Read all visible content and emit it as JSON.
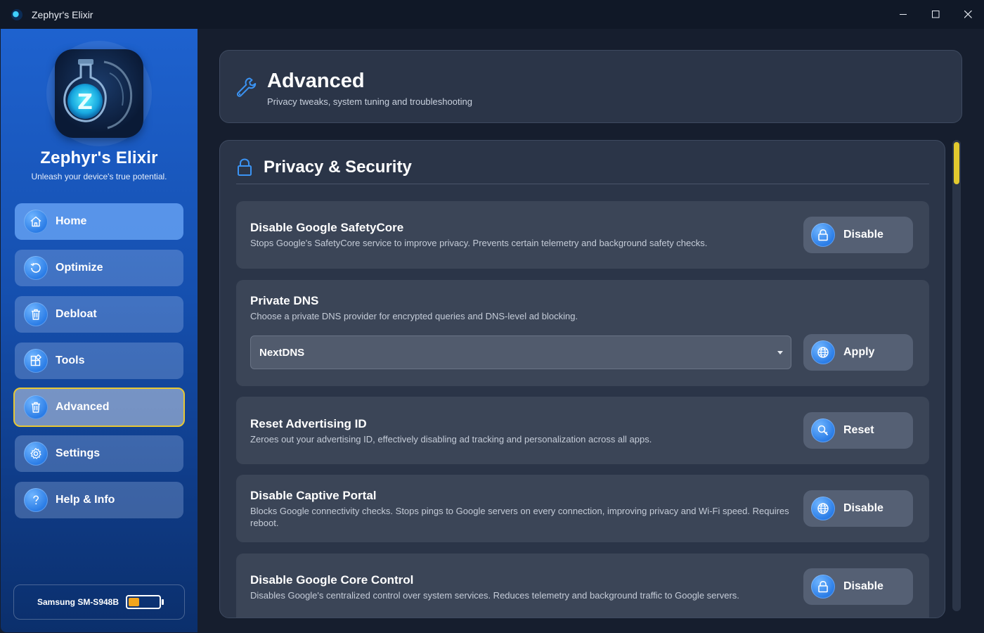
{
  "window": {
    "title": "Zephyr's Elixir"
  },
  "brand": {
    "name": "Zephyr's Elixir",
    "tagline": "Unleash your device's true potential."
  },
  "nav": [
    {
      "label": "Home",
      "icon": "home-icon"
    },
    {
      "label": "Optimize",
      "icon": "refresh-icon"
    },
    {
      "label": "Debloat",
      "icon": "trash-icon"
    },
    {
      "label": "Tools",
      "icon": "tools-icon"
    },
    {
      "label": "Advanced",
      "icon": "trash-icon",
      "active": true
    },
    {
      "label": "Settings",
      "icon": "gear-icon"
    },
    {
      "label": "Help & Info",
      "icon": "help-icon"
    }
  ],
  "device": {
    "name": "Samsung SM-S948B",
    "battery_level": 0.35
  },
  "header": {
    "title": "Advanced",
    "subtitle": "Privacy tweaks, system tuning and troubleshooting"
  },
  "section": {
    "title": "Privacy & Security"
  },
  "options": [
    {
      "title": "Disable Google SafetyCore",
      "desc": "Stops Google's SafetyCore service to improve privacy. Prevents certain telemetry and background safety checks.",
      "button": "Disable",
      "icon": "lock-icon"
    },
    {
      "title": "Private DNS",
      "desc": "Choose a private DNS provider for encrypted queries and DNS-level ad blocking.",
      "select_value": "NextDNS",
      "button": "Apply",
      "icon": "globe-icon"
    },
    {
      "title": "Reset Advertising ID",
      "desc": "Zeroes out your advertising ID, effectively disabling ad tracking and personalization across all apps.",
      "button": "Reset",
      "icon": "search-key-icon"
    },
    {
      "title": "Disable Captive Portal",
      "desc": "Blocks Google connectivity checks. Stops pings to Google servers on every connection, improving privacy and Wi-Fi speed. Requires reboot.",
      "button": "Disable",
      "icon": "globe-icon"
    },
    {
      "title": "Disable Google Core Control",
      "desc": "Disables Google's centralized control over system services. Reduces telemetry and background traffic to Google servers.",
      "button": "Disable",
      "icon": "lock-icon"
    }
  ],
  "colors": {
    "accent": "#2a7ce6",
    "active_border": "#e6c735",
    "battery": "#f2a51d",
    "scroll_thumb": "#e2c92e"
  }
}
